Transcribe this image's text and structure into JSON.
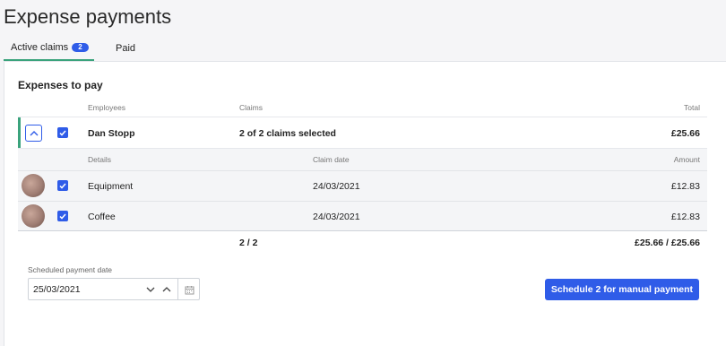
{
  "page": {
    "title": "Expense payments"
  },
  "tabs": [
    {
      "label": "Active claims",
      "badge": "2",
      "active": true
    },
    {
      "label": "Paid",
      "active": false
    }
  ],
  "section": {
    "title": "Expenses to pay"
  },
  "table": {
    "headers": {
      "employees": "Employees",
      "claims": "Claims",
      "total": "Total"
    },
    "employee_row": {
      "name": "Dan Stopp",
      "claims_selected": "2 of 2 claims selected",
      "total": "£25.66",
      "checked": true,
      "expanded": true
    },
    "detail_headers": {
      "details": "Details",
      "claim_date": "Claim date",
      "amount": "Amount"
    },
    "details": [
      {
        "detail": "Equipment",
        "claim_date": "24/03/2021",
        "amount": "£12.83",
        "checked": true
      },
      {
        "detail": "Coffee",
        "claim_date": "24/03/2021",
        "amount": "£12.83",
        "checked": true
      }
    ],
    "summary": {
      "count": "2 / 2",
      "total": "£25.66 / £25.66"
    }
  },
  "schedule": {
    "label": "Scheduled payment date",
    "value": "25/03/2021",
    "button_label": "Schedule 2 for manual payment"
  },
  "colors": {
    "accent": "#2f5ce8",
    "active_tab": "#3aa37c",
    "row_highlight": "#3aa37c"
  },
  "icons": {
    "collapse": "chevron-up-icon",
    "checkbox": "check-icon",
    "date_down": "chevron-down-icon",
    "date_up": "chevron-up-icon",
    "calendar": "calendar-icon"
  }
}
